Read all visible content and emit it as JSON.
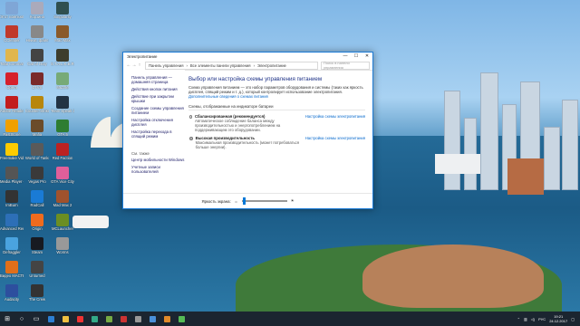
{
  "desktop_icons": [
    {
      "label": "Этот компьютер",
      "color": "#7fa6d6"
    },
    {
      "label": "CCleaner",
      "color": "#c0392b"
    },
    {
      "label": "Total Commander",
      "color": "#e0b64e"
    },
    {
      "label": "Opera",
      "color": "#d6212c"
    },
    {
      "label": "Adobe Reader",
      "color": "#c21d1d"
    },
    {
      "label": "FastStone",
      "color": "#f0a000"
    },
    {
      "label": "Freemake Video C...",
      "color": "#ffcc00"
    },
    {
      "label": "Media Player Classic",
      "color": "#555"
    },
    {
      "label": "ImBurn",
      "color": "#333"
    },
    {
      "label": "Advanced Renamer",
      "color": "#2d6fb7"
    },
    {
      "label": "Defraggler",
      "color": "#4aa3df"
    },
    {
      "label": "Видео МАСТЕР",
      "color": "#e06f1a"
    },
    {
      "label": "Audacity",
      "color": "#2d4f9e"
    },
    {
      "label": "Корзина",
      "color": "#aab"
    },
    {
      "label": "Неизв. файл",
      "color": "#888"
    },
    {
      "label": "Call of Duty",
      "color": "#444"
    },
    {
      "label": "ZTVS",
      "color": "#7a2a2a"
    },
    {
      "label": "Counter-Strike",
      "color": "#b8860b"
    },
    {
      "label": "Mafia",
      "color": "#6b4c2a"
    },
    {
      "label": "World of Tanks",
      "color": "#5a5a5a"
    },
    {
      "label": "Vegas Pro",
      "color": "#3a3a3a"
    },
    {
      "label": "RadCall",
      "color": "#1a7bd5"
    },
    {
      "label": "Origin",
      "color": "#f06b1e"
    },
    {
      "label": "Steam",
      "color": "#171a21"
    },
    {
      "label": "Unturned",
      "color": "#444"
    },
    {
      "label": "The Crew",
      "color": "#333"
    },
    {
      "label": "Singularity",
      "color": "#2f4f4f"
    },
    {
      "label": "Mad Max",
      "color": "#8a5a2b"
    },
    {
      "label": "S.T.A.L.K.E.R.",
      "color": "#3d3d2d"
    },
    {
      "label": "Muzzle",
      "color": "#7a7"
    },
    {
      "label": "Team Speak 3 Client",
      "color": "#234"
    },
    {
      "label": "GTA 5",
      "color": "#2e7d32"
    },
    {
      "label": "Red Faction",
      "color": "#b22"
    },
    {
      "label": "GTA Vice City",
      "color": "#e05f9a"
    },
    {
      "label": "Mad Max 2",
      "color": "#a0522d"
    },
    {
      "label": "MCLauncher",
      "color": "#6b8e23"
    },
    {
      "label": "Worms",
      "color": "#999"
    }
  ],
  "window": {
    "title": "Электропитание",
    "min": "—",
    "max": "☐",
    "close": "✕",
    "path": [
      "Панель управления",
      "Все элементы панели управления",
      "Электропитание"
    ],
    "search_placeholder": "Поиск в панели управления",
    "left_links": [
      "Панель управления — домашняя страница",
      "Действия кнопок питания",
      "Действие при закрытии крышки",
      "Создание схемы управления питанием",
      "Настройка отключения дисплея",
      "Настройка перехода в спящий режим"
    ],
    "see_also": "См. также",
    "see_also_links": [
      "Центр мобильности Windows",
      "Учетные записи пользователей"
    ],
    "heading": "Выбор или настройка схемы управления питанием",
    "intro": "Схема управления питанием — это набор параметров оборудования и системы (таких как яркость дисплея, спящий режим и т. д.), который контролирует использование электропитания.",
    "intro_link": "Дополнительные сведения о схемах питания",
    "group": "Схемы, отображаемые на индикаторе батареи",
    "plans": [
      {
        "name": "Сбалансированная (рекомендуется)",
        "desc": "Автоматическое соблюдение баланса между производительностью и энергопотреблением на поддерживающем это оборудовании.",
        "setting": "Настройка схемы электропитания",
        "checked": false
      },
      {
        "name": "Высокая производительность",
        "desc": "Максимальная производительность (может потребоваться больше энергии).",
        "setting": "Настройка схемы электропитания",
        "checked": true
      }
    ],
    "brightness_label": "Яркость экрана:",
    "brightness_value": 0.05
  },
  "taskbar": {
    "lang": "РУС",
    "time": "19:21",
    "date": "24.12.2017"
  }
}
